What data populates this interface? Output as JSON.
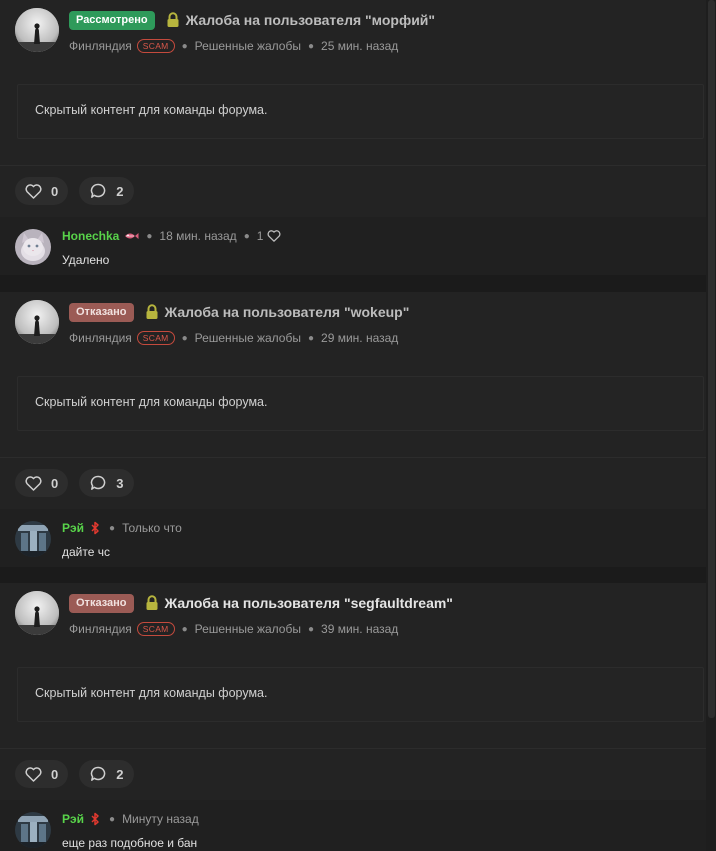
{
  "threads": [
    {
      "status": "Рассмотрено",
      "title": "Жалоба на пользователя \"морфий\"",
      "author": "Финляндия",
      "tag": "SCAM",
      "forum": "Решенные жалобы",
      "time": "25 мин. назад",
      "content": "Скрытый контент для команды форума.",
      "likes": "0",
      "comments": "2",
      "last_comment": {
        "author": "Honechka",
        "time": "18 мин. назад",
        "likes": "1",
        "text": "Удалено"
      }
    },
    {
      "status": "Отказано",
      "title": "Жалоба на пользователя \"wokeup\"",
      "author": "Финляндия",
      "tag": "SCAM",
      "forum": "Решенные жалобы",
      "time": "29 мин. назад",
      "content": "Скрытый контент для команды форума.",
      "likes": "0",
      "comments": "3",
      "last_comment": {
        "author": "Рэй",
        "time": "Только что",
        "text": "дайте чс"
      }
    },
    {
      "status": "Отказано",
      "title": "Жалоба на пользователя \"segfaultdream\"",
      "author": "Финляндия",
      "tag": "SCAM",
      "forum": "Решенные жалобы",
      "time": "39 мин. назад",
      "content": "Скрытый контент для команды форума.",
      "likes": "0",
      "comments": "2",
      "last_comment": {
        "author": "Рэй",
        "time": "Минуту назад",
        "text": "еще раз подобное и бан"
      }
    }
  ],
  "colors": {
    "badge_reviewed": "#2e9a5a",
    "badge_denied": "#9b5b55",
    "scam_tag": "#d9574a",
    "username_green": "#58d34a",
    "lock_icon": "#b7b53e"
  },
  "icons": {
    "lock": "lock-icon",
    "like": "heart-icon",
    "comment": "comment-bubble-icon",
    "honechka_badge": "fish-badge-icon",
    "ray_badge": "bluetooth-rune-icon"
  }
}
